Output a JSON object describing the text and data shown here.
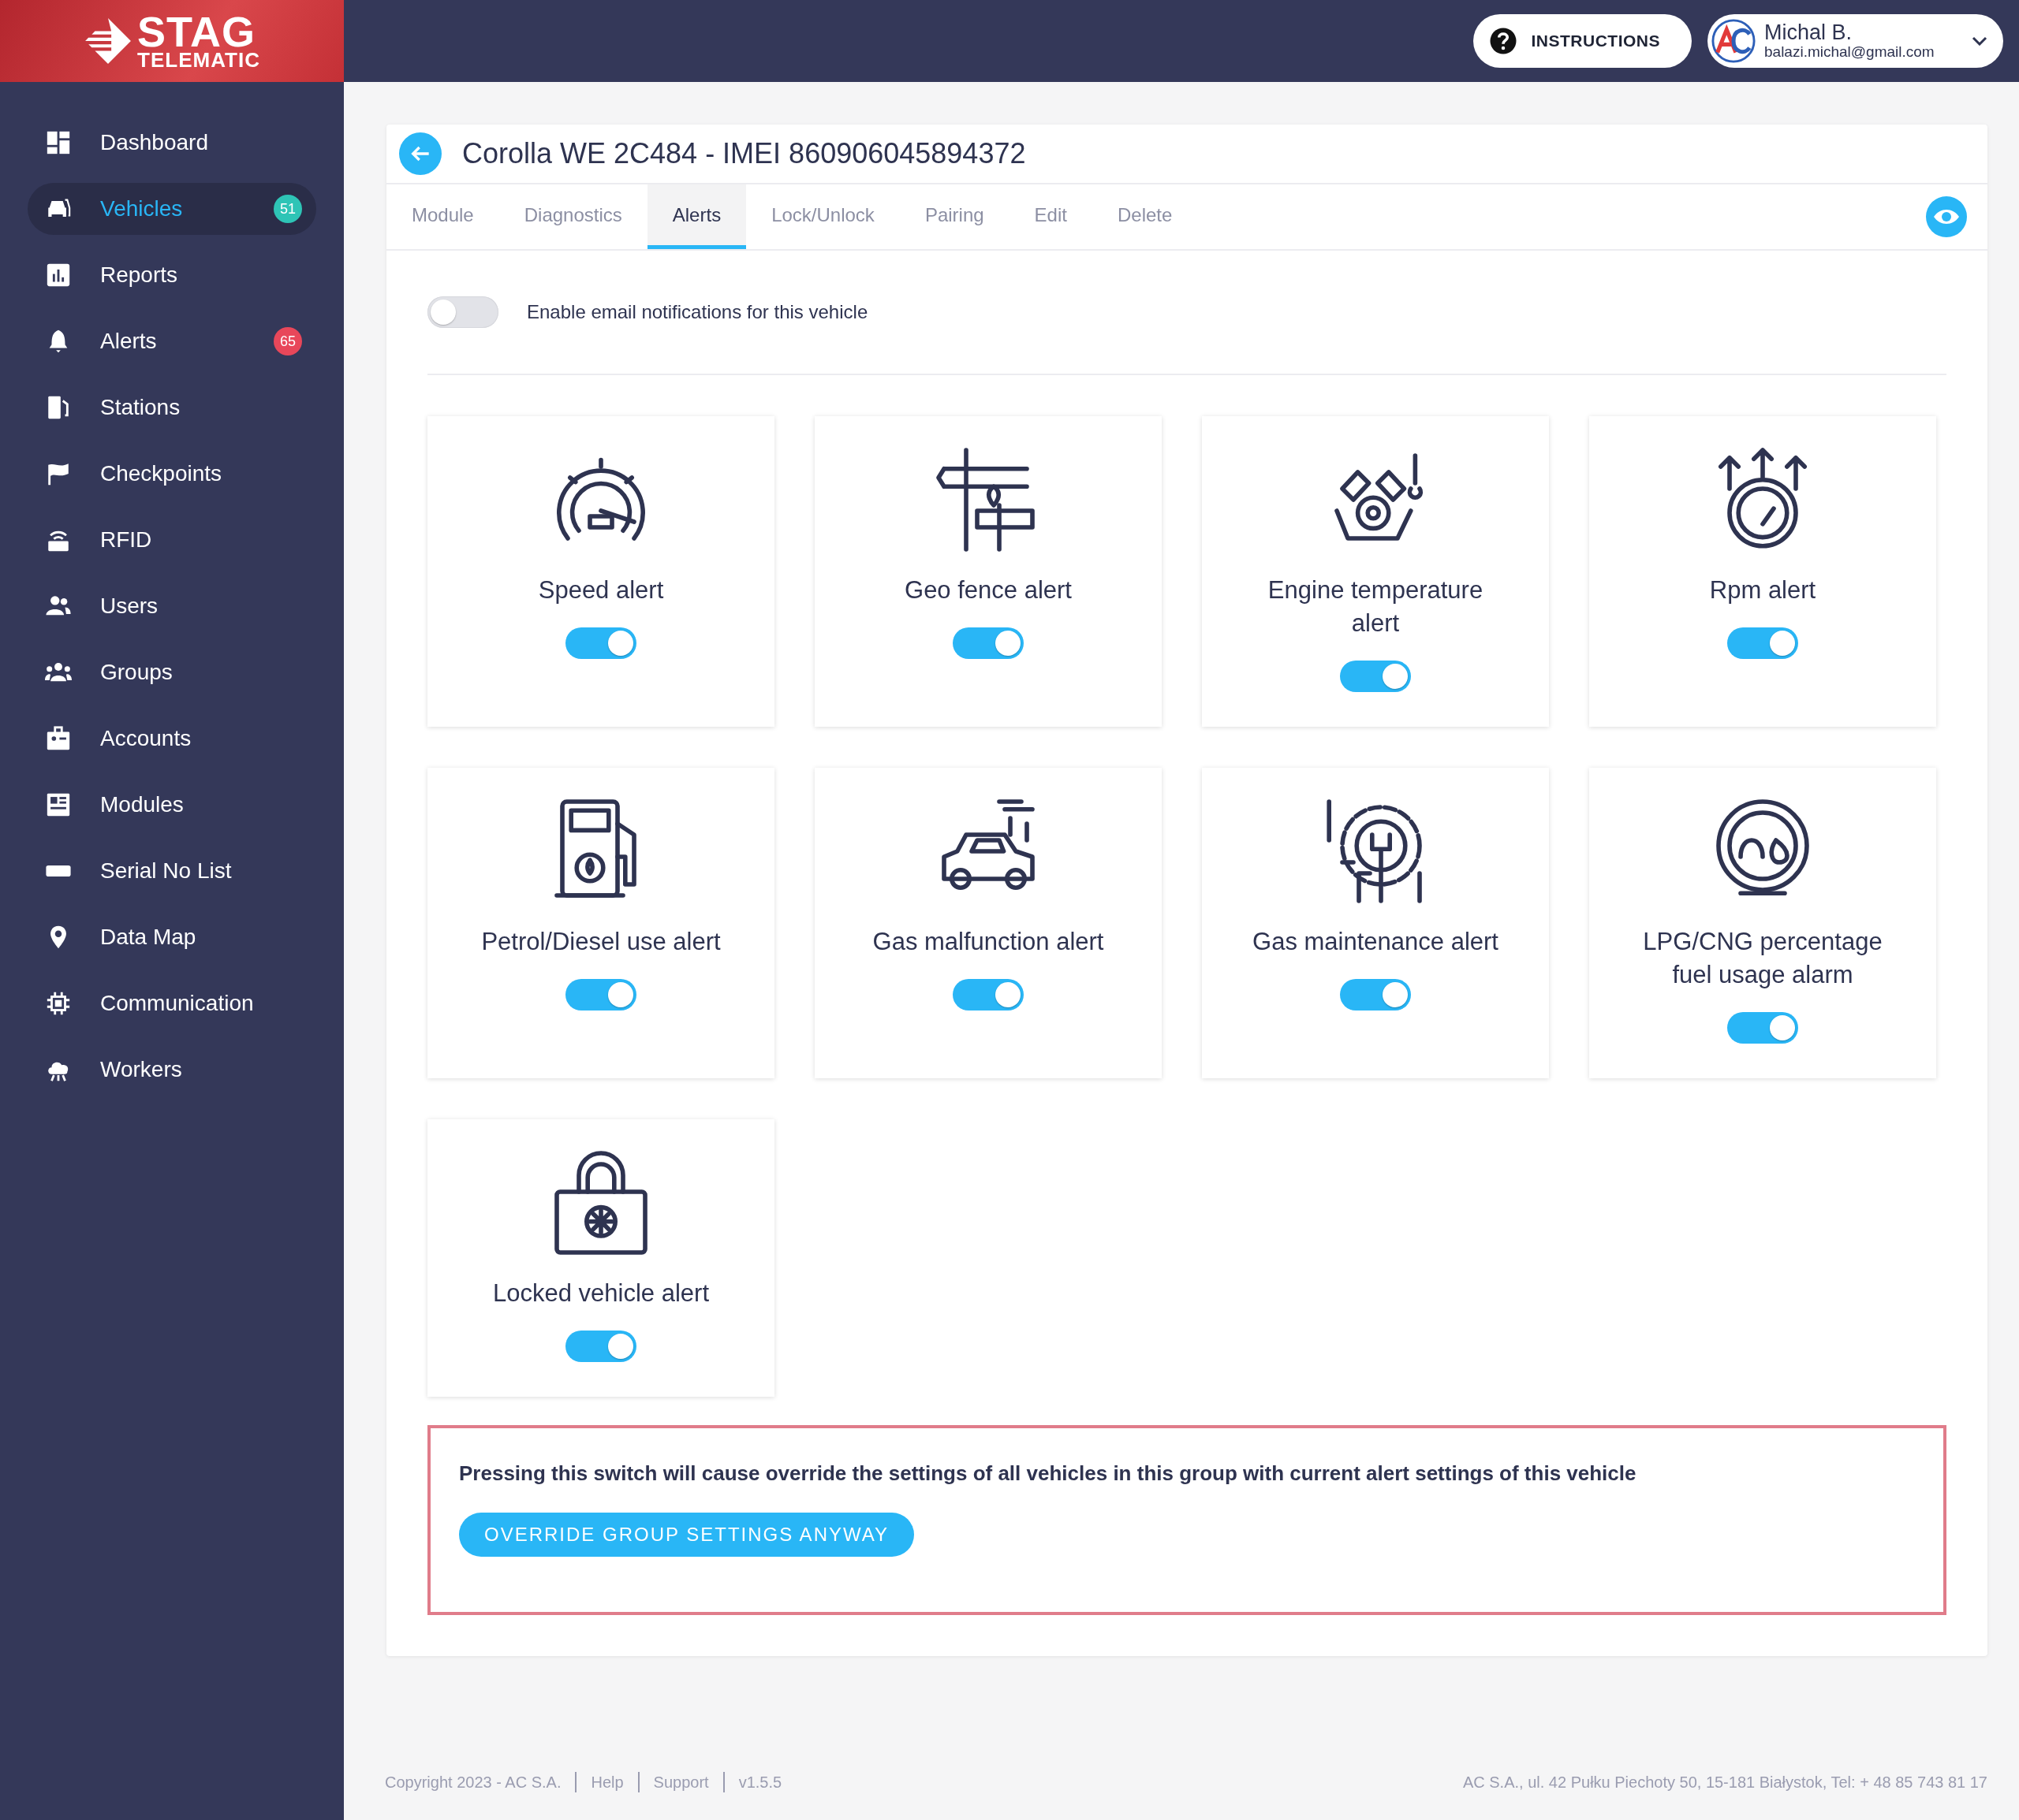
{
  "logo": {
    "title": "STAG",
    "subtitle": "TELEMATIC"
  },
  "header": {
    "instructions": "INSTRUCTIONS",
    "user": {
      "name": "Michal B.",
      "email": "balazi.michal@gmail.com"
    }
  },
  "sidebar": {
    "items": [
      {
        "label": "Dashboard",
        "selected": false
      },
      {
        "label": "Vehicles",
        "selected": true,
        "badge": {
          "text": "51",
          "color": "#2ec4b6"
        }
      },
      {
        "label": "Reports",
        "selected": false
      },
      {
        "label": "Alerts",
        "selected": false,
        "badge": {
          "text": "65",
          "color": "#e8475a"
        }
      },
      {
        "label": "Stations",
        "selected": false
      },
      {
        "label": "Checkpoints",
        "selected": false
      },
      {
        "label": "RFID",
        "selected": false
      },
      {
        "label": "Users",
        "selected": false
      },
      {
        "label": "Groups",
        "selected": false
      },
      {
        "label": "Accounts",
        "selected": false
      },
      {
        "label": "Modules",
        "selected": false
      },
      {
        "label": "Serial No List",
        "selected": false
      },
      {
        "label": "Data Map",
        "selected": false
      },
      {
        "label": "Communication",
        "selected": false
      },
      {
        "label": "Workers",
        "selected": false
      }
    ]
  },
  "vehicle": {
    "title": "Corolla WE 2C484 - IMEI 860906045894372"
  },
  "tabs": [
    {
      "label": "Module",
      "selected": false
    },
    {
      "label": "Diagnostics",
      "selected": false
    },
    {
      "label": "Alerts",
      "selected": true
    },
    {
      "label": "Lock/Unlock",
      "selected": false
    },
    {
      "label": "Pairing",
      "selected": false
    },
    {
      "label": "Edit",
      "selected": false
    },
    {
      "label": "Delete",
      "selected": false
    }
  ],
  "email_notifications": {
    "label": "Enable email notifications for this vehicle",
    "on": false
  },
  "alerts": [
    {
      "label": "Speed alert",
      "on": true
    },
    {
      "label": "Geo fence alert",
      "on": true
    },
    {
      "label": "Engine temperature alert",
      "on": true
    },
    {
      "label": "Rpm alert",
      "on": true
    },
    {
      "label": "Petrol/Diesel use alert",
      "on": true
    },
    {
      "label": "Gas malfunction alert",
      "on": true
    },
    {
      "label": "Gas maintenance alert",
      "on": true
    },
    {
      "label": "LPG/CNG percentage fuel usage alarm",
      "on": true
    },
    {
      "label": "Locked vehicle alert",
      "on": true
    }
  ],
  "override": {
    "message": "Pressing this switch will cause override the settings of all vehicles in this group with current alert settings of this vehicle",
    "button": "OVERRIDE GROUP SETTINGS ANYWAY"
  },
  "footer": {
    "links": [
      "Copyright 2023 - AC S.A.",
      "Help",
      "Support",
      "v1.5.5"
    ],
    "address": "AC S.A., ul. 42 Pułku Piechoty 50, 15-181 Białystok, Tel: + 48 85 743 81 17"
  }
}
